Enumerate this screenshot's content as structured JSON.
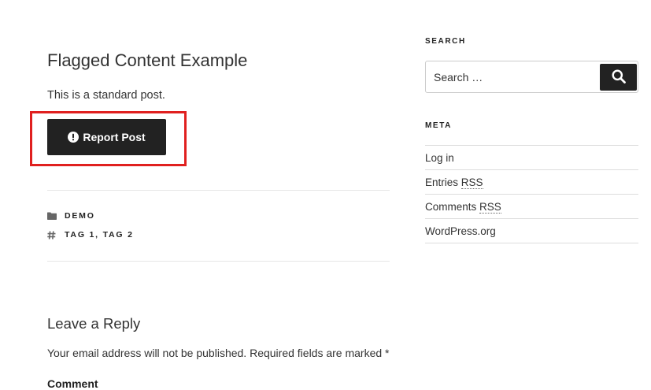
{
  "post": {
    "title": "Flagged Content Example",
    "content": "This is a standard post.",
    "report_button_label": "Report Post"
  },
  "meta": {
    "category": "DEMO",
    "tags": "TAG 1, TAG 2"
  },
  "reply": {
    "title": "Leave a Reply",
    "note": "Your email address will not be published. Required fields are marked *",
    "comment_label": "Comment"
  },
  "sidebar": {
    "search_title": "SEARCH",
    "search_placeholder": "Search …",
    "meta_title": "META",
    "links": [
      {
        "label": "Log in"
      },
      {
        "label": "Entries ",
        "abbr": "RSS"
      },
      {
        "label": "Comments ",
        "abbr": "RSS"
      },
      {
        "label": "WordPress.org"
      }
    ]
  },
  "icons": {
    "report": "exclamation-circle-icon",
    "category": "folder-icon",
    "tags": "hashtag-icon",
    "search": "search-icon"
  },
  "colors": {
    "button_bg": "#222222",
    "highlight": "#e0201f"
  }
}
